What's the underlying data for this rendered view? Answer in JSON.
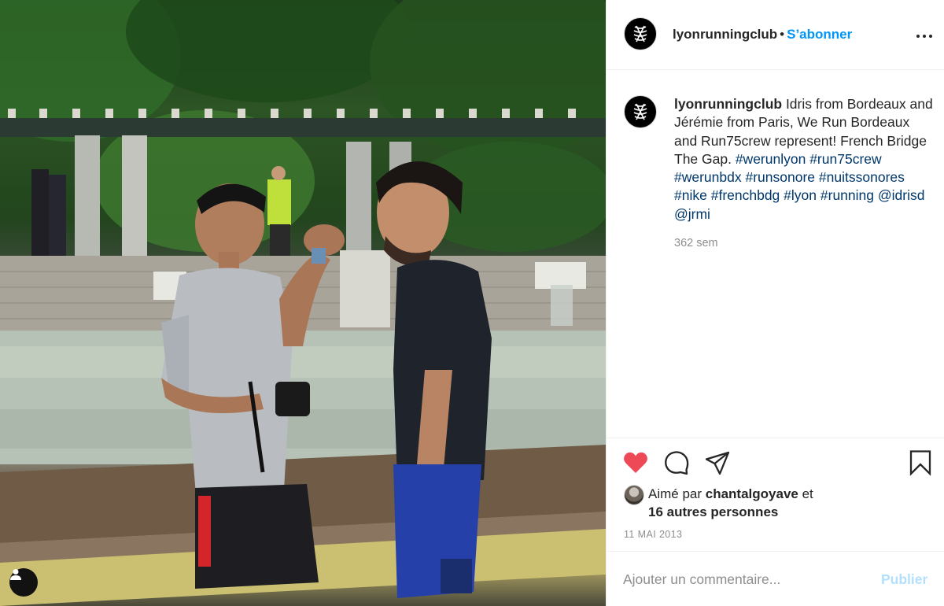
{
  "post": {
    "username": "lyonrunningclub",
    "separator": "•",
    "follow_label": "S’abonner",
    "more_icon": "more-horizontal-icon",
    "image_alt": "Deux coureurs discutant devant une fontaine"
  },
  "caption": {
    "username": "lyonrunningclub",
    "text": " Idris from Bordeaux and Jérémie from Paris, We Run Bordeaux and Run75crew represent! French Bridge The Gap. ",
    "hashtags": [
      "#werunlyon",
      "#run75crew",
      "#werunbdx",
      "#runsonore",
      "#nuitssonores",
      "#nike",
      "#frenchbdg",
      "#lyon",
      "#running"
    ],
    "mentions": [
      "@idrisd",
      "@jrmi"
    ],
    "time_ago": "362 sem"
  },
  "actions": {
    "like_icon": "heart-filled-icon",
    "comment_icon": "comment-bubble-icon",
    "share_icon": "paper-plane-icon",
    "save_icon": "bookmark-icon",
    "liked_color": "#ed4956"
  },
  "likes": {
    "prefix": "Aimé par ",
    "user": "chantalgoyave",
    "connector": " et",
    "others": "16 autres personnes"
  },
  "post_date": "11 MAI 2013",
  "comment": {
    "placeholder": "Ajouter un commentaire...",
    "publish_label": "Publier"
  },
  "colors": {
    "accent": "#0095f6",
    "hashtag": "#00376b",
    "muted": "#8e8e8e",
    "publish_disabled": "#b2dffc"
  }
}
